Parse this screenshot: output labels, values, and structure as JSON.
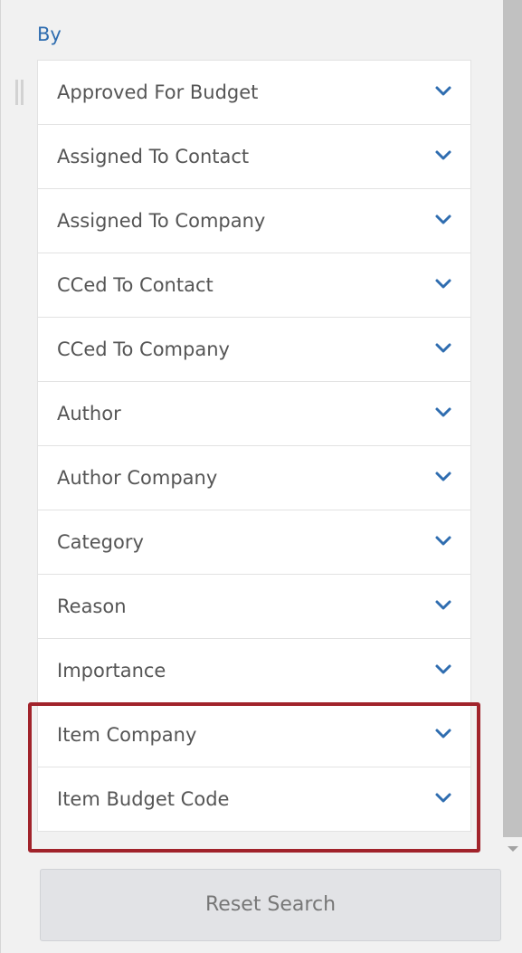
{
  "section": {
    "label": "By"
  },
  "filters": [
    {
      "label": "Approved For Budget",
      "icon": "chevron-down-icon"
    },
    {
      "label": "Assigned To Contact",
      "icon": "chevron-down-icon"
    },
    {
      "label": "Assigned To Company",
      "icon": "chevron-down-icon"
    },
    {
      "label": "CCed To Contact",
      "icon": "chevron-down-icon"
    },
    {
      "label": "CCed To Company",
      "icon": "chevron-down-icon"
    },
    {
      "label": "Author",
      "icon": "chevron-down-icon"
    },
    {
      "label": "Author Company",
      "icon": "chevron-down-icon"
    },
    {
      "label": "Category",
      "icon": "chevron-down-icon"
    },
    {
      "label": "Reason",
      "icon": "chevron-down-icon"
    },
    {
      "label": "Importance",
      "icon": "chevron-down-icon"
    },
    {
      "label": "Item Company",
      "icon": "chevron-down-icon"
    },
    {
      "label": "Item Budget Code",
      "icon": "chevron-down-icon"
    }
  ],
  "reset_button": {
    "label": "Reset Search"
  },
  "colors": {
    "accent": "#2f6db0",
    "highlight": "#a1232b",
    "label_text": "#555555",
    "panel_bg": "#f1f1f1"
  }
}
